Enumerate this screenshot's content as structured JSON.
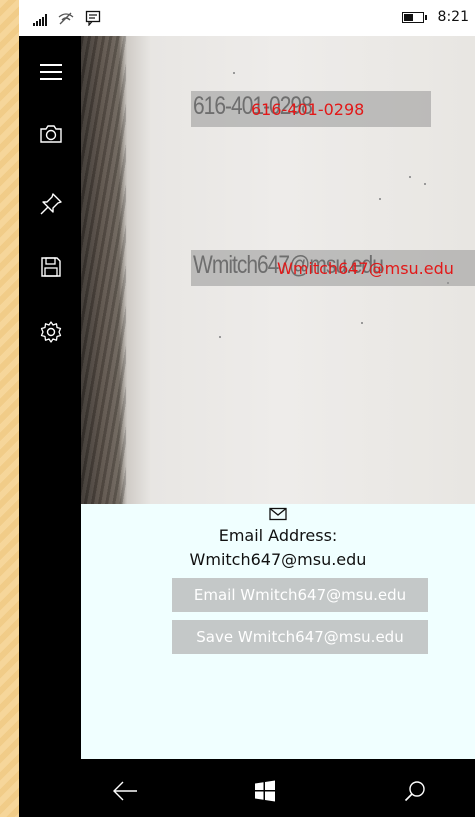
{
  "status_bar": {
    "time": "8:21",
    "icons": [
      "signal-icon",
      "wifi-icon",
      "message-icon",
      "battery-icon"
    ]
  },
  "app_bar": {
    "items": [
      "hamburger-menu-icon",
      "camera-icon",
      "pin-icon",
      "save-icon",
      "settings-icon"
    ]
  },
  "camera_view": {
    "phone": {
      "raw_text": "616-401-0298",
      "overlay_text": "616-401-0298"
    },
    "email": {
      "raw_text": "Wmitch647@msu.edu",
      "overlay_text": "Wmitch647@msu.edu"
    },
    "overlay_color": "#e21818"
  },
  "panel": {
    "icon": "mail-icon",
    "label": "Email Address:",
    "value": "Wmitch647@msu.edu",
    "email_button": "Email Wmitch647@msu.edu",
    "save_button": "Save Wmitch647@msu.edu"
  },
  "nav_bar": {
    "items": [
      "back-icon",
      "windows-start-icon",
      "search-icon"
    ]
  },
  "colors": {
    "panel_background": "#f0ffff",
    "button_background": "#c4c8c8",
    "overlay_text": "#e21818"
  }
}
